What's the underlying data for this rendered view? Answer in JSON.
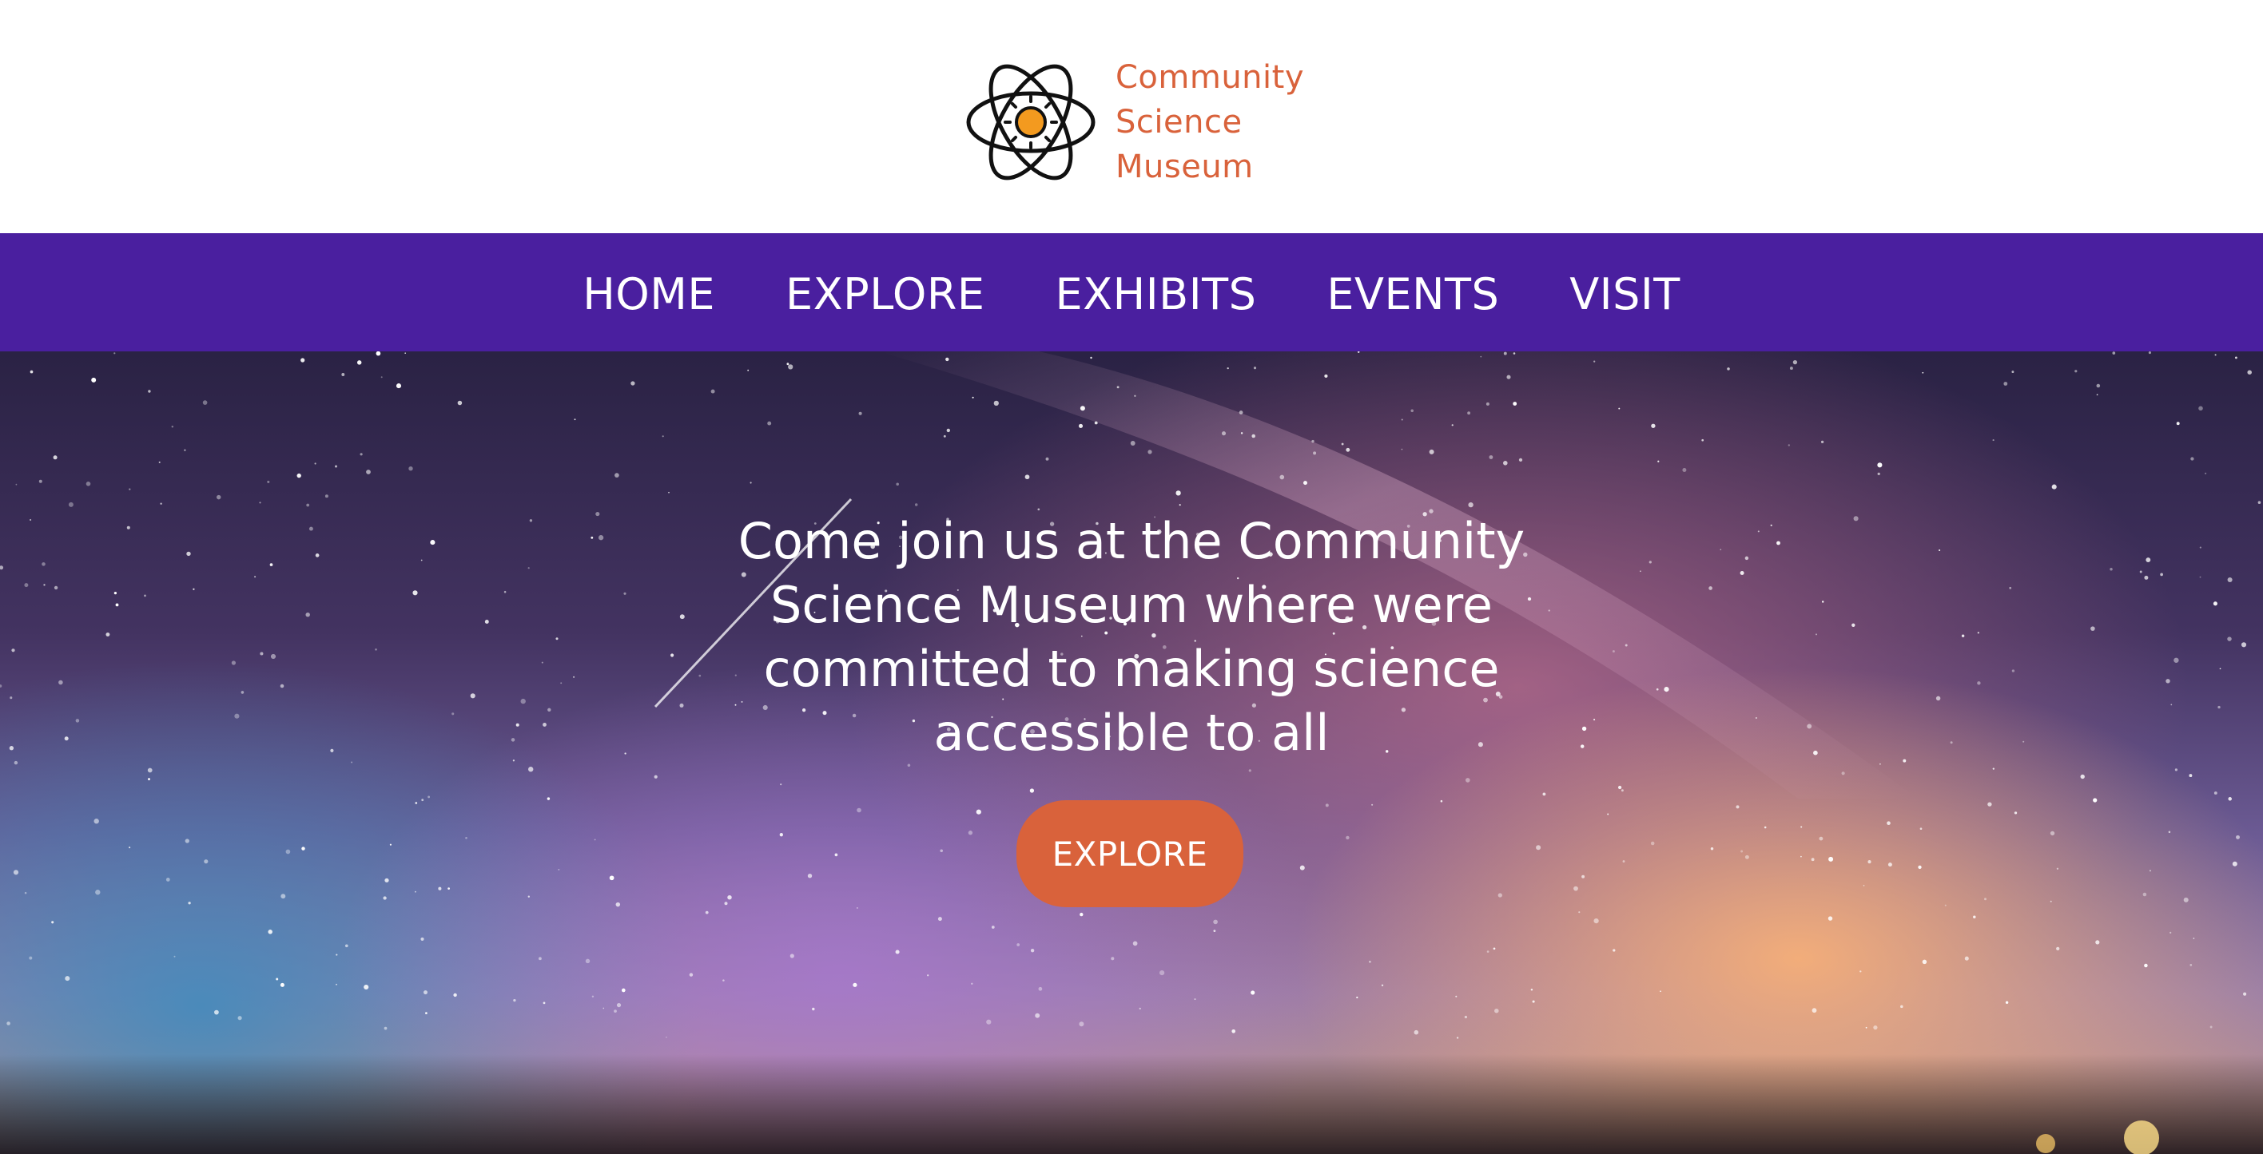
{
  "header": {
    "logo": {
      "name_lines": [
        "Community",
        "Science",
        "Museum"
      ],
      "brand_color": "#d9623b",
      "icon": "atom-icon"
    }
  },
  "nav": {
    "background": "#4a1f9f",
    "items": [
      {
        "label": "HOME"
      },
      {
        "label": "EXPLORE"
      },
      {
        "label": "EXHIBITS"
      },
      {
        "label": "EVENTS"
      },
      {
        "label": "VISIT"
      }
    ]
  },
  "hero": {
    "headline": "Come join us at the Community Science Museum where were committed to making science accessible to all",
    "cta_label": "EXPLORE",
    "cta_color": "#d9623b"
  }
}
